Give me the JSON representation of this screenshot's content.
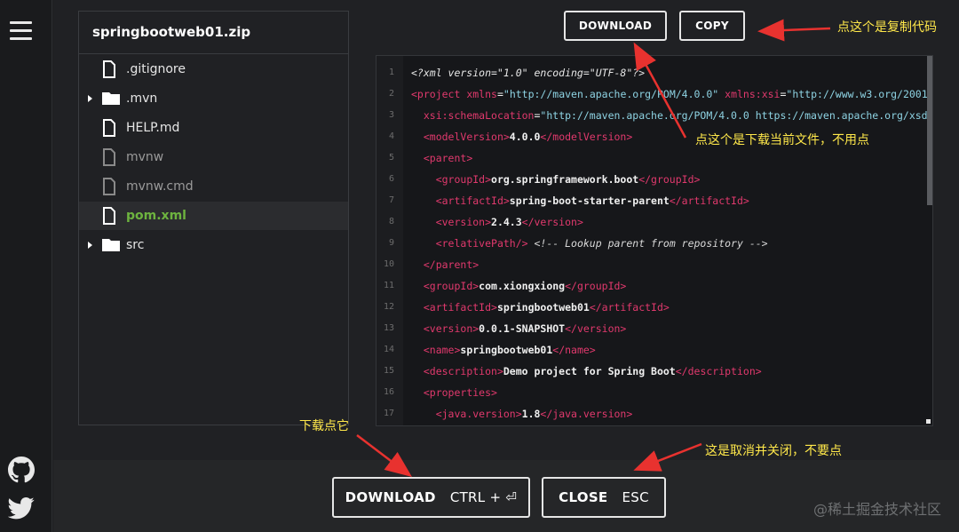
{
  "tree": {
    "title": "springbootweb01.zip",
    "items": [
      {
        "label": ".gitignore"
      },
      {
        "label": ".mvn"
      },
      {
        "label": "HELP.md"
      },
      {
        "label": "mvnw"
      },
      {
        "label": "mvnw.cmd"
      },
      {
        "label": "pom.xml"
      },
      {
        "label": "src"
      }
    ]
  },
  "toolbar": {
    "download_label": "DOWNLOAD",
    "copy_label": "COPY"
  },
  "footer": {
    "download_label": "DOWNLOAD",
    "download_shortcut": "CTRL + ⏎",
    "close_label": "CLOSE",
    "close_shortcut": "ESC"
  },
  "code": {
    "line_numbers": [
      "1",
      "2",
      "3",
      "4",
      "5",
      "6",
      "7",
      "8",
      "9",
      "10",
      "11",
      "12",
      "13",
      "14",
      "15",
      "16",
      "17"
    ]
  },
  "annotations": {
    "copy_note": "点这个是复制代码",
    "download_top_note": "点这个是下载当前文件，不用点",
    "download_note": "下载点它",
    "close_note": "这是取消并关闭，不要点"
  },
  "watermark": "@稀土掘金技术社区",
  "colors": {
    "accent_green": "#6db33f",
    "tag_pink": "#e1396d",
    "string_cyan": "#8ed3e3",
    "annotation_yellow": "#ffe84a",
    "arrow_red": "#e8322f"
  },
  "icons": {
    "menu": "hamburger-icon",
    "github": "github-icon",
    "twitter": "twitter-icon"
  }
}
